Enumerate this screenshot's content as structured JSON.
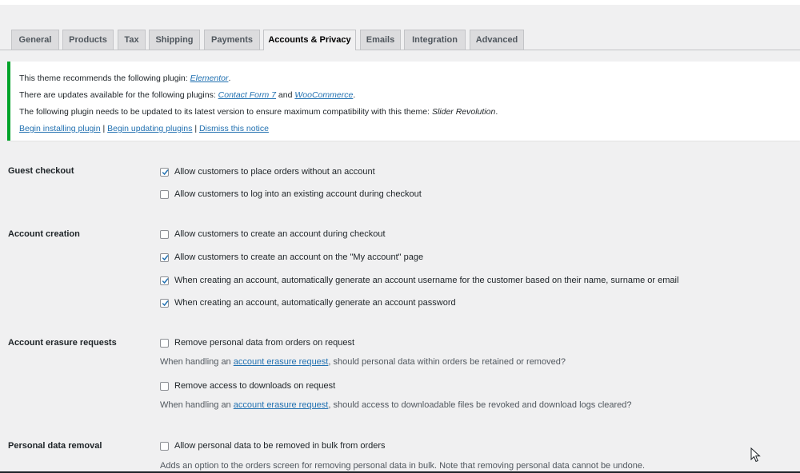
{
  "tabs": [
    "General",
    "Products",
    "Tax",
    "Shipping",
    "Payments",
    "Accounts & Privacy",
    "Emails",
    "Integration",
    "Advanced"
  ],
  "notice": {
    "line1_prefix": "This theme recommends the following plugin: ",
    "line1_link": "Elementor",
    "line1_suffix": ".",
    "line2_prefix": "There are updates available for the following plugins: ",
    "line2_link1": "Contact Form 7",
    "line2_mid": " and ",
    "line2_link2": "WooCommerce",
    "line2_suffix": ".",
    "line3_prefix": "The following plugin needs to be updated to its latest version to ensure maximum compatibility with this theme: ",
    "line3_plugin": "Slider Revolution",
    "line3_suffix": ".",
    "link_install": "Begin installing plugin",
    "sep": " | ",
    "link_update": "Begin updating plugins",
    "link_dismiss": "Dismiss this notice"
  },
  "settings": {
    "guest_checkout": {
      "label": "Guest checkout",
      "opt1": "Allow customers to place orders without an account",
      "opt2": "Allow customers to log into an existing account during checkout"
    },
    "account_creation": {
      "label": "Account creation",
      "opt1": "Allow customers to create an account during checkout",
      "opt2": "Allow customers to create an account on the \"My account\" page",
      "opt3": "When creating an account, automatically generate an account username for the customer based on their name, surname or email",
      "opt4": "When creating an account, automatically generate an account password"
    },
    "erasure": {
      "label": "Account erasure requests",
      "opt1": "Remove personal data from orders on request",
      "desc1_prefix": "When handling an ",
      "desc1_link": "account erasure request",
      "desc1_suffix": ", should personal data within orders be retained or removed?",
      "opt2": "Remove access to downloads on request",
      "desc2_prefix": "When handling an ",
      "desc2_link": "account erasure request",
      "desc2_suffix": ", should access to downloadable files be revoked and download logs cleared?"
    },
    "removal": {
      "label": "Personal data removal",
      "opt1": "Allow personal data to be removed in bulk from orders",
      "desc1": "Adds an option to the orders screen for removing personal data in bulk. Note that removing personal data cannot be undone."
    }
  },
  "checked": {
    "guest_opt1": true,
    "guest_opt2": false,
    "creation_opt1": false,
    "creation_opt2": true,
    "creation_opt3": true,
    "creation_opt4": true,
    "erasure_opt1": false,
    "erasure_opt2": false,
    "removal_opt1": false
  },
  "colors": {
    "link": "#2271b1",
    "notice_border": "#00a32a",
    "tab_bg": "#dcdcde",
    "page_bg": "#f0f0f1"
  }
}
